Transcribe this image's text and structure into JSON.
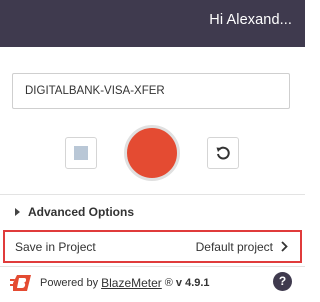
{
  "header": {
    "greeting": "Hi Alexand..."
  },
  "recording": {
    "name_value": "DIGITALBANK-VISA-XFER"
  },
  "controls": {
    "stop_icon": "stop-icon",
    "record_icon": "record-icon",
    "reset_icon": "reset-icon"
  },
  "advanced": {
    "label": "Advanced Options"
  },
  "project": {
    "label": "Save in Project",
    "value": "Default project"
  },
  "footer": {
    "powered_by": "Powered by",
    "brand": "BlazeMeter",
    "registered": "®",
    "version": "v 4.9.1",
    "help_label": "?"
  },
  "colors": {
    "header_bg": "#3f3a4e",
    "record": "#e44b32",
    "highlight": "#e03b3b",
    "stop_square": "#b9c7d6"
  }
}
